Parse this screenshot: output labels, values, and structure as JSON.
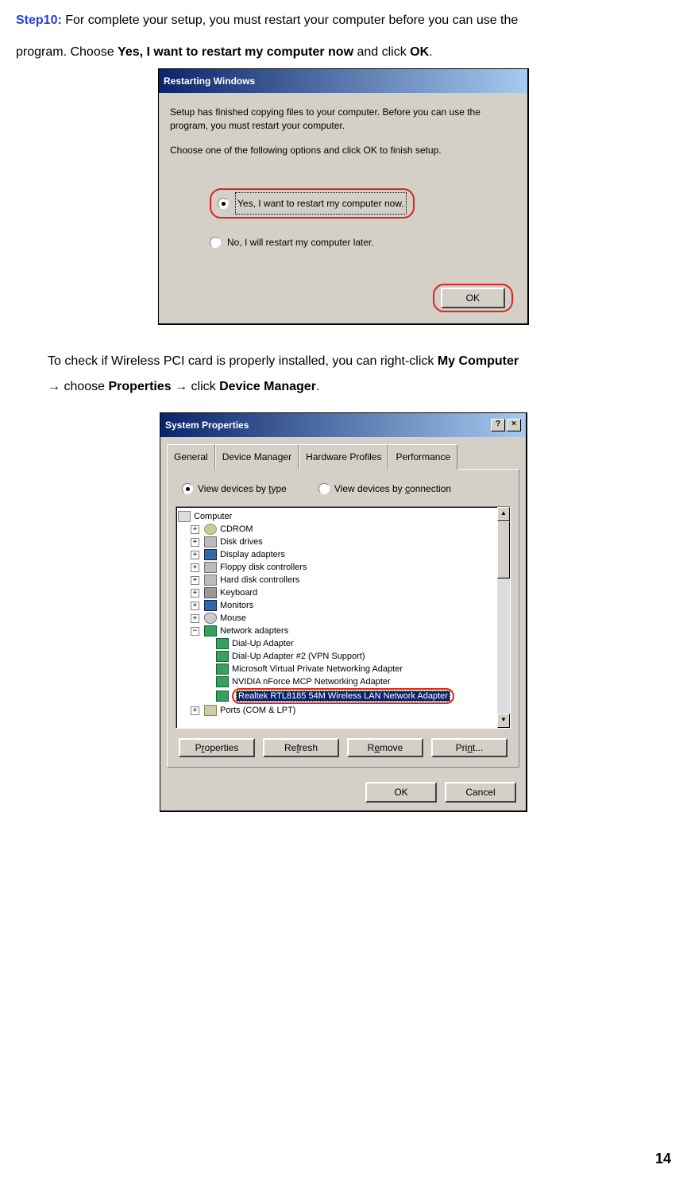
{
  "intro": {
    "step_label": "Step10:",
    "text_a": " For complete your setup, you must restart your computer before you can use the",
    "text_b": "program. Choose ",
    "bold_choice": "Yes, I want to restart my computer now",
    "text_c": " and click ",
    "bold_ok": "OK",
    "text_d": "."
  },
  "dialog1": {
    "title": "Restarting Windows",
    "msg1": "Setup has finished copying files to your computer.  Before you can use the program, you must restart your computer.",
    "msg2": "Choose one of the following options and click OK to finish setup.",
    "opt_yes": "Yes, I want to restart my computer now.",
    "opt_no": "No, I will restart my computer later.",
    "ok": "OK"
  },
  "middle": {
    "text_a": "To check if Wireless PCI card is properly installed, you can right-click ",
    "bold_my": "My Computer",
    "arrow": " → ",
    "text_b": "choose ",
    "bold_prop": "Properties",
    "text_c": " click ",
    "bold_dm": "Device Manager",
    "text_d": "."
  },
  "dialog2": {
    "title": "System Properties",
    "tabs": {
      "general": "General",
      "devmgr": "Device Manager",
      "hw": "Hardware Profiles",
      "perf": "Performance"
    },
    "view_type_pre": "View devices by ",
    "view_type_u": "t",
    "view_type_post": "ype",
    "view_conn_pre": "View devices by ",
    "view_conn_u": "c",
    "view_conn_post": "onnection",
    "tree": {
      "root": "Computer",
      "items": [
        "CDROM",
        "Disk drives",
        "Display adapters",
        "Floppy disk controllers",
        "Hard disk controllers",
        "Keyboard",
        "Monitors",
        "Mouse",
        "Network adapters",
        "Ports (COM & LPT)"
      ],
      "net_children": [
        "Dial-Up Adapter",
        "Dial-Up Adapter #2 (VPN Support)",
        "Microsoft Virtual Private Networking Adapter",
        "NVIDIA nForce MCP Networking Adapter",
        "Realtek RTL8185 54M Wireless LAN Network Adapter"
      ]
    },
    "btn_prop_pre": "P",
    "btn_prop_u": "r",
    "btn_prop_post": "operties",
    "btn_ref_pre": "Re",
    "btn_ref_u": "f",
    "btn_ref_post": "resh",
    "btn_rem_pre": "R",
    "btn_rem_u": "e",
    "btn_rem_post": "move",
    "btn_print_pre": "Pri",
    "btn_print_u": "n",
    "btn_print_post": "t...",
    "ok": "OK",
    "cancel": "Cancel",
    "help": "?",
    "close": "×"
  },
  "page_number": "14"
}
